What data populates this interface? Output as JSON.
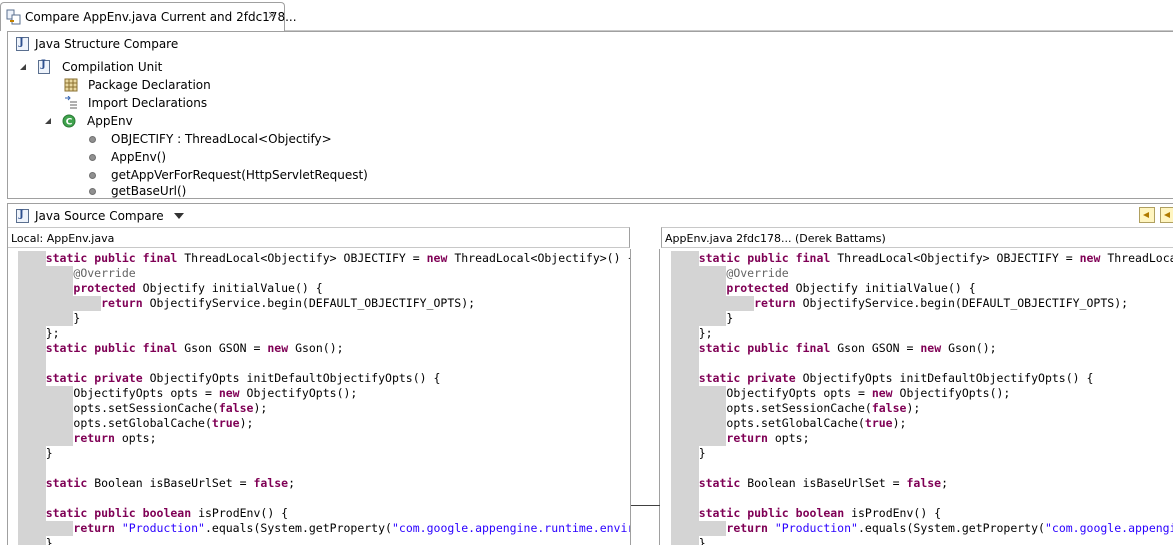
{
  "tab": {
    "title": "Compare AppEnv.java Current and 2fdc178...",
    "icon": "java-compare-icon"
  },
  "structure": {
    "title": "Java Structure Compare",
    "items": [
      {
        "label": "Compilation Unit",
        "icon": "java-file-icon"
      },
      {
        "label": "Package Declaration",
        "icon": "package-icon"
      },
      {
        "label": "Import Declarations",
        "icon": "imports-icon"
      },
      {
        "label": "AppEnv",
        "icon": "class-icon"
      },
      {
        "label": "OBJECTIFY : ThreadLocal<Objectify>",
        "icon": "field-icon"
      },
      {
        "label": "AppEnv()",
        "icon": "method-icon"
      },
      {
        "label": "getAppVerForRequest(HttpServletRequest)",
        "icon": "method-icon"
      },
      {
        "label": "getBaseUrl()",
        "icon": "method-icon"
      }
    ]
  },
  "source": {
    "title": "Java Source Compare",
    "left_title": "Local: AppEnv.java",
    "right_title": "AppEnv.java 2fdc178... (Derek Battams)"
  },
  "code": {
    "left": [
      "    static public final ThreadLocal<Objectify> OBJECTIFY = new ThreadLocal<Objectify>() {",
      "        @Override",
      "        protected Objectify initialValue() {",
      "            return ObjectifyService.begin(DEFAULT_OBJECTIFY_OPTS);",
      "        }",
      "    };",
      "    static public final Gson GSON = new Gson();",
      "",
      "    static private ObjectifyOpts initDefaultObjectifyOpts() {",
      "        ObjectifyOpts opts = new ObjectifyOpts();",
      "        opts.setSessionCache(false);",
      "        opts.setGlobalCache(true);",
      "        return opts;",
      "    }",
      "",
      "    static Boolean isBaseUrlSet = false;",
      "",
      "    static public boolean isProdEnv() {",
      "        return \"Production\".equals(System.getProperty(\"com.google.appengine.runtime.environment\"));",
      "    }"
    ],
    "right": [
      "    static public final ThreadLocal<Objectify> OBJECTIFY = new ThreadLocal<Objectify>() {",
      "        @Override",
      "        protected Objectify initialValue() {",
      "            return ObjectifyService.begin(DEFAULT_OBJECTIFY_OPTS);",
      "        }",
      "    };",
      "    static public final Gson GSON = new Gson();",
      "",
      "    static private ObjectifyOpts initDefaultObjectifyOpts() {",
      "        ObjectifyOpts opts = new ObjectifyOpts();",
      "        opts.setSessionCache(false);",
      "        opts.setGlobalCache(true);",
      "        return opts;",
      "    }",
      "",
      "    static Boolean isBaseUrlSet = false;",
      "",
      "    static public boolean isProdEnv() {",
      "        return \"Production\".equals(System.getProperty(\"com.google.appengine.runtime.environment\"));",
      "    }"
    ]
  }
}
